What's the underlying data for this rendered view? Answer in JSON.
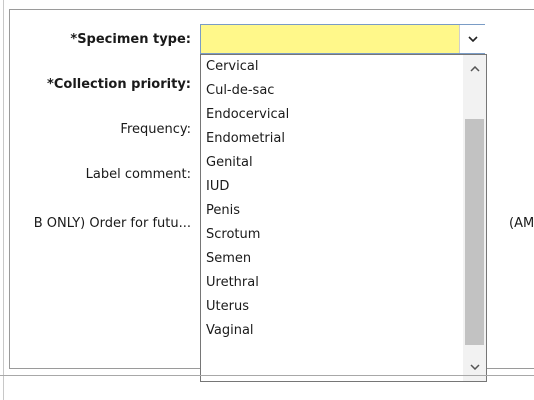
{
  "form": {
    "specimen_type_label": "*Specimen type:",
    "specimen_type_value": "",
    "collection_priority_label": "*Collection priority:",
    "frequency_label": "Frequency:",
    "label_comment_label": "Label comment:",
    "order_future_label": "B ONLY) Order for futu...",
    "right_truncated_text": "(AM"
  },
  "dropdown": {
    "options": [
      "Cervical",
      "Cul-de-sac",
      "Endocervical",
      "Endometrial",
      "Genital",
      "IUD",
      "Penis",
      "Scrotum",
      "Semen",
      "Urethral",
      "Uterus",
      "Vaginal"
    ],
    "scroll_position_fraction": 0.2
  },
  "icons": {
    "combo_arrow": "chevron-down-icon",
    "scroll_up": "scroll-up-arrow-icon",
    "scroll_down": "scroll-down-arrow-icon"
  },
  "colors": {
    "field_highlight": "#fff88a",
    "combo_border": "#7a9cc6",
    "scroll_thumb": "#c2c2c2"
  }
}
